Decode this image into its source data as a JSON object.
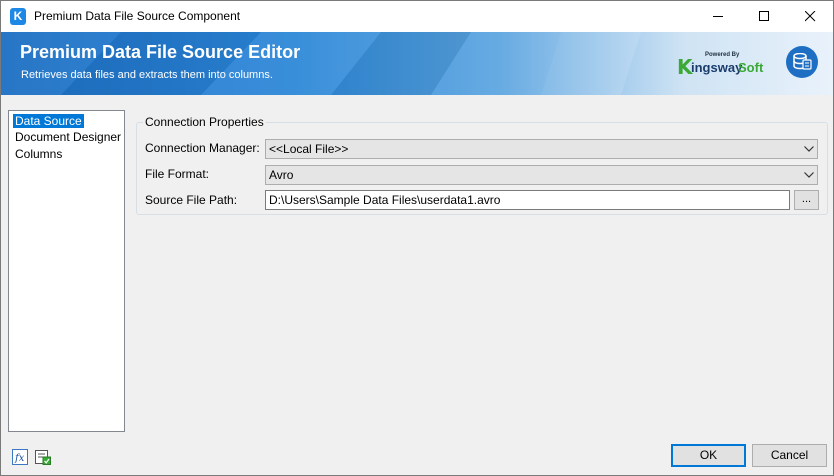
{
  "window": {
    "title": "Premium Data File Source Component",
    "app_icon_letter": "K",
    "controls": {
      "minimize": "minimize-icon",
      "maximize": "maximize-icon",
      "close": "close-icon"
    }
  },
  "banner": {
    "title": "Premium Data File Source Editor",
    "subtitle": "Retrieves data files and extracts them into columns.",
    "brand": {
      "powered_by": "Powered By",
      "k": "K",
      "ingsway": "ingsway",
      "soft": "Soft"
    },
    "brand_colors": {
      "navy": "#1b3d6d",
      "green": "#3aa935"
    },
    "icon": "database-icon"
  },
  "nav": {
    "items": [
      {
        "label": "Data Source",
        "selected": true
      },
      {
        "label": "Document Designer",
        "selected": false
      },
      {
        "label": "Columns",
        "selected": false
      }
    ],
    "selection_color": "#0078d7"
  },
  "connection": {
    "legend": "Connection Properties",
    "manager_label": "Connection Manager:",
    "manager_value": "<<Local File>>",
    "format_label": "File Format:",
    "format_value": "Avro",
    "path_label": "Source File Path:",
    "path_value": "D:\\Users\\Sample Data Files\\userdata1.avro",
    "browse_label": "..."
  },
  "footer": {
    "icons": [
      "expression-icon",
      "variables-icon"
    ],
    "ok_label": "OK",
    "cancel_label": "Cancel"
  }
}
